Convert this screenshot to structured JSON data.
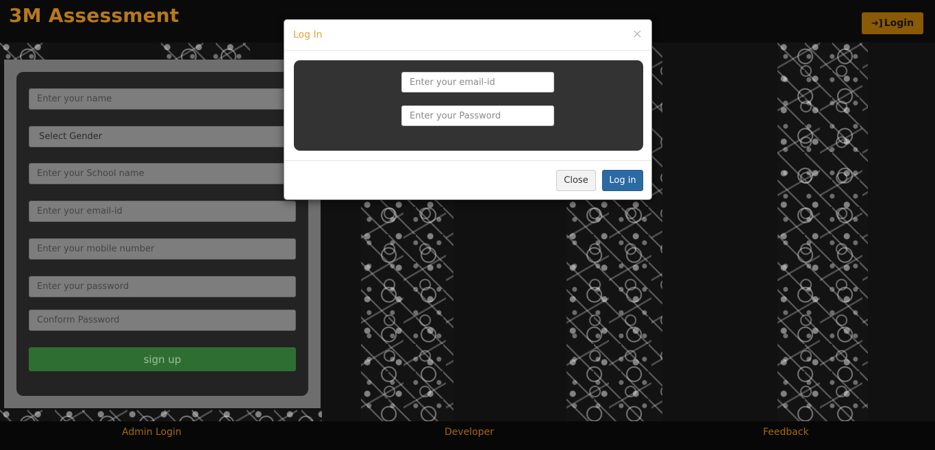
{
  "header": {
    "brand": "3M Assessment",
    "login_label": "Login"
  },
  "signup": {
    "name_placeholder": "Enter your name",
    "gender_selected": "Select Gender",
    "school_placeholder": "Enter your School name",
    "email_placeholder": "Enter your email-id",
    "mobile_placeholder": "Enter your mobile number",
    "password_placeholder": "Enter your password",
    "confirm_placeholder": "Conform Password",
    "submit_label": "sign up"
  },
  "modal": {
    "title": "Log In",
    "close_x": "×",
    "email_placeholder": "Enter your email-id",
    "password_placeholder": "Enter your Password",
    "close_label": "Close",
    "login_label": "Log in"
  },
  "footer": {
    "admin_login": "Admin Login",
    "developer": "Developer",
    "feedback": "Feedback"
  },
  "colors": {
    "brand": "#b7791c",
    "accent_button": "#8a5a06",
    "signup_button": "#2f6e33",
    "primary_button": "#2c6aa3",
    "modal_title": "#e8a23a"
  }
}
